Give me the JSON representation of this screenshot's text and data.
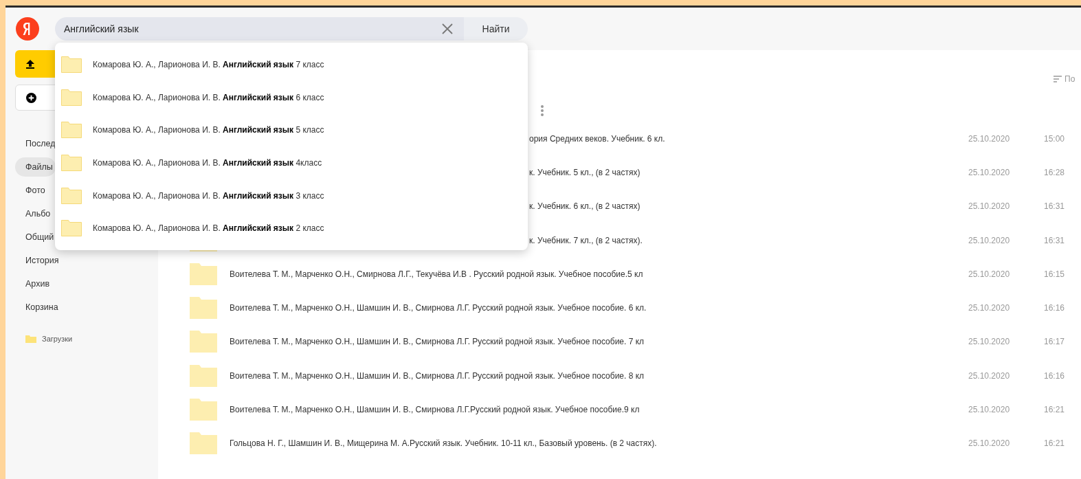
{
  "search": {
    "value": "Английский язык",
    "button": "Найти"
  },
  "suggestions": [
    {
      "text": "Комарова Ю. А., Ларионова И. В. **Английский язык** 7 класс"
    },
    {
      "text": "Комарова Ю. А., Ларионова И. В. **Английский язык** 6 класс"
    },
    {
      "text": "Комарова Ю. А., Ларионова И. В. **Английский язык** 5 класс"
    },
    {
      "text": "Комарова Ю. А., Ларионова И. В. **Английский язык** 4класс"
    },
    {
      "text": "Комарова Ю. А., Ларионова И. В. **Английский язык** 3 класс"
    },
    {
      "text": "Комарова Ю. А., Ларионова И. В. **Английский язык** 2 класс"
    }
  ],
  "sidebar": {
    "items": [
      {
        "label": "Послед",
        "selected": false
      },
      {
        "label": "Файлы",
        "selected": true
      },
      {
        "label": "Фото",
        "selected": false
      },
      {
        "label": "Альбо",
        "selected": false
      },
      {
        "label": "Общий",
        "selected": false
      },
      {
        "label": "История",
        "selected": false
      },
      {
        "label": "Архив",
        "selected": false
      },
      {
        "label": "Корзина",
        "selected": false
      }
    ],
    "folders": [
      "Загрузки"
    ]
  },
  "sort": {
    "label": "По"
  },
  "files": [
    {
      "kind": "covered",
      "name": "ория Средних веков. Учебник. 6 кл.",
      "date": "25.10.2020",
      "time": "15:00"
    },
    {
      "kind": "covered",
      "name": "к. Учебник. 5 кл., (в 2 частях)",
      "date": "25.10.2020",
      "time": "16:28"
    },
    {
      "kind": "covered",
      "name": "к. Учебник. 6 кл., (в 2 частях)",
      "date": "25.10.2020",
      "time": "16:31"
    },
    {
      "kind": "covered",
      "name": "к. Учебник. 7 кл., (в 2 частях).",
      "date": "25.10.2020",
      "time": "16:31"
    },
    {
      "kind": "full",
      "name": "Воителева Т. М., Марченко О.Н., Смирнова Л.Г., Текучёва И.В . Русский родной язык. Учебное пособие.5 кл",
      "date": "25.10.2020",
      "time": "16:15"
    },
    {
      "kind": "full",
      "name": "Воителева Т. М., Марченко О.Н., Шамшин И. В., Смирнова Л.Г. Русский родной язык. Учебное пособие. 6 кл.",
      "date": "25.10.2020",
      "time": "16:16"
    },
    {
      "kind": "full",
      "name": "Воителева Т. М., Марченко О.Н., Шамшин И. В., Смирнова Л.Г. Русский родной язык. Учебное пособие. 7 кл",
      "date": "25.10.2020",
      "time": "16:17"
    },
    {
      "kind": "full",
      "name": "Воителева Т. М., Марченко О.Н., Шамшин И. В., Смирнова Л.Г. Русский родной язык. Учебное пособие. 8 кл",
      "date": "25.10.2020",
      "time": "16:16"
    },
    {
      "kind": "full",
      "name": "Воителева Т. М., Марченко О.Н., Шамшин И. В., Смирнова Л.Г.Русский родной язык. Учебное пособие.9 кл",
      "date": "25.10.2020",
      "time": "16:21"
    },
    {
      "kind": "full",
      "name": "Гольцова Н. Г., Шамшин И. В., Мищерина М. А.Русский язык. Учебник. 10-11 кл., Базовый уровень. (в 2 частях).",
      "date": "25.10.2020",
      "time": "16:21"
    }
  ]
}
